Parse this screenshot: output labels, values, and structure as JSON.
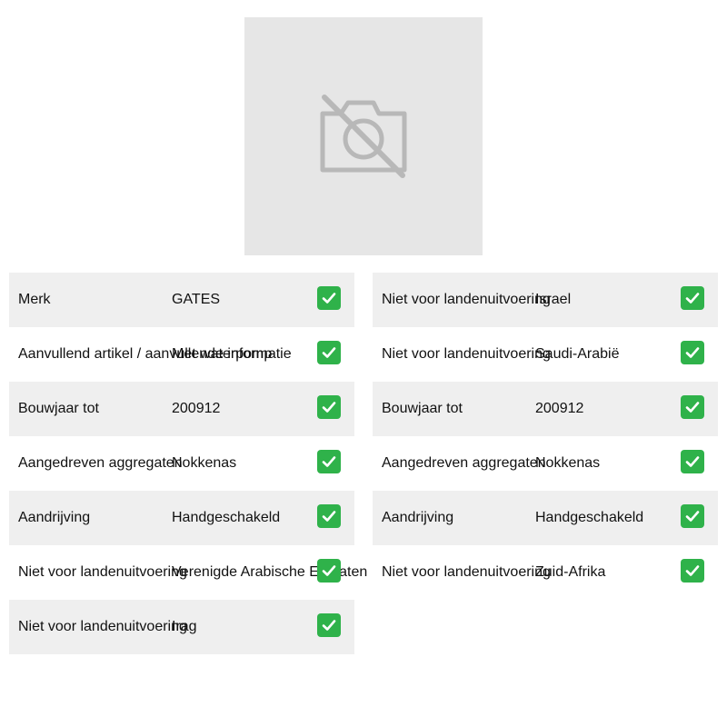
{
  "image": {
    "placeholder_icon": "camera-off-icon"
  },
  "left_column": [
    {
      "label": "Merk",
      "value": "GATES"
    },
    {
      "label": "Aanvullend artikel / aanvullende informatie",
      "value": "Met waterpomp"
    },
    {
      "label": "Bouwjaar tot",
      "value": "200912"
    },
    {
      "label": "Aangedreven aggregaten",
      "value": "Nokkenas"
    },
    {
      "label": "Aandrijving",
      "value": "Handgeschakeld"
    },
    {
      "label": "Niet voor landenuitvoering",
      "value": "Verenigde Arabische Emiraten"
    },
    {
      "label": "Niet voor landenuitvoering",
      "value": "Irag"
    }
  ],
  "right_column": [
    {
      "label": "Niet voor landenuitvoering",
      "value": "Israel"
    },
    {
      "label": "Niet voor landenuitvoering",
      "value": "Saudi-Arabië"
    },
    {
      "label": "Bouwjaar tot",
      "value": "200912"
    },
    {
      "label": "Aangedreven aggregaten",
      "value": "Nokkenas"
    },
    {
      "label": "Aandrijving",
      "value": "Handgeschakeld"
    },
    {
      "label": "Niet voor landenuitvoering",
      "value": "Zuid-Afrika"
    }
  ],
  "colors": {
    "check_green": "#2fb24a",
    "row_shade": "#efefef",
    "image_bg": "#e6e6e6"
  }
}
